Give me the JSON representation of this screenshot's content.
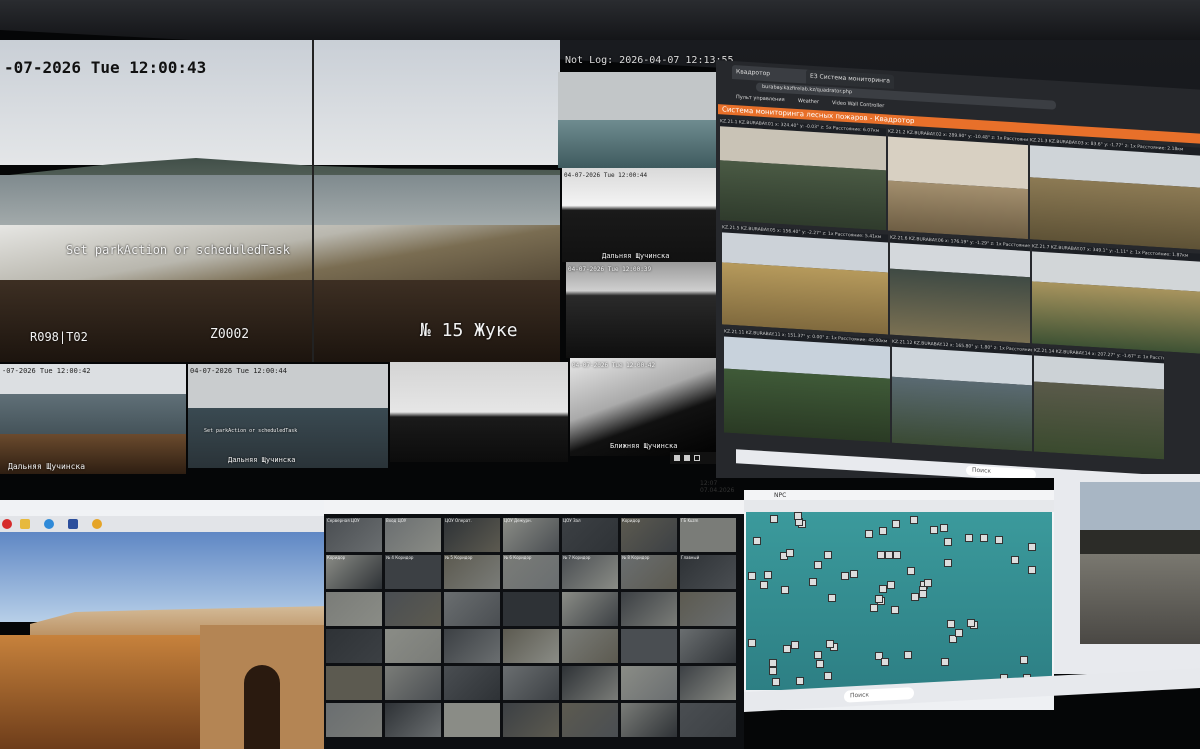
{
  "upper_wall": {
    "main_camera": {
      "timestamp": "-07-2026 Tue 12:00:43",
      "task_text": "Set parkAction or scheduledTask",
      "left_code": "R098|T02",
      "mid_code": "Z0002",
      "camera_name": "№ 15 Жуке"
    },
    "top_strip_timestamp": "Not Log: 2026-04-07 12:13:55",
    "small_cams": [
      {
        "timestamp": "-07-2026 Tue 12:00:42",
        "caption": "Дальняя Щучинска"
      },
      {
        "timestamp": "04-07-2026 Tue 12:00:44",
        "task_text": "Set parkAction or scheduledTask",
        "caption": "Дальняя Щучинска"
      },
      {
        "timestamp": "04-07-2026 Tue 12:00:44",
        "caption": "Дальняя Щучинска"
      },
      {
        "timestamp": "04-07-2026 Tue 12:00:39",
        "caption": ""
      },
      {
        "timestamp": "04-07-2026 Tue 12:00:42",
        "caption": "Ближняя Щучинска"
      }
    ],
    "browser": {
      "tab1": "Квадротор",
      "tab2": "ЕЗ Система мониторинга лес...",
      "url": "burabay.kazfirelab.kz/quadrator.php",
      "bookmark1": "Пульт управления",
      "bookmark2": "Weather",
      "bookmark3": "Video Wall Controller",
      "banner": "Система мониторинга лесных пожаров - Квадротор",
      "cells": [
        "KZ.21.1 KZ.BURABAY.01 x: 324.40° y: -0.03° z: 5x Расстояние: 6.07км",
        "KZ.21.2 KZ.BURABAY.02 x: 289.90° y: -10.48° z: 1x Расстояние: 10.18км",
        "KZ.21.3 KZ.BURABAY.03 x: 83.6° y: -1.77° z: 1x Расстояние: 2.18км",
        "KZ.21.5 KZ.BURABAY.05 x: 156.40° y: -2.27° z: 1x Расстояние: 5.41км",
        "KZ.21.6 KZ.BURABAY.06 x: 176.19° y: -1.29° z: 1x Расстояние: 5.81км",
        "KZ.21.7 KZ.BURABAY.07 x: 349.1° y: -1.11° z: 1x Расстояние: 1.87км",
        "KZ.21.11 KZ.BURABAY.11 x: 151.37° y: 0.00° z: 1x Расстояние: 45.00км",
        "KZ.21.12 KZ.BURABAY.12 x: 165.80° y: 1.80° z: 1x Расстояние: 5.40км",
        "KZ.21.14 KZ.BURABAY.14 x: 207.27° y: -1.67° z: 1x Расстояние: 9.40км"
      ]
    },
    "clock": {
      "time": "12:07",
      "date": "07.04.2026"
    }
  },
  "lower_wall": {
    "cctv_labels": [
      "Серверная ЦОУ",
      "Вход ЦОУ",
      "ЦОУ Операт.",
      "ЦОУ Дежурн.",
      "ЦОУ Зал",
      "Коридор",
      "ГБ Kuzm",
      "Коридор",
      "№ 4 Коридор",
      "№ 5 Коридор",
      "№ 6 Коридор",
      "№ 7 Коридор",
      "№ 8 Коридор",
      "Главный"
    ],
    "network_map_title": "NPC",
    "taskbar_search": "Поиск",
    "taskbar_search2": "Поиск"
  }
}
